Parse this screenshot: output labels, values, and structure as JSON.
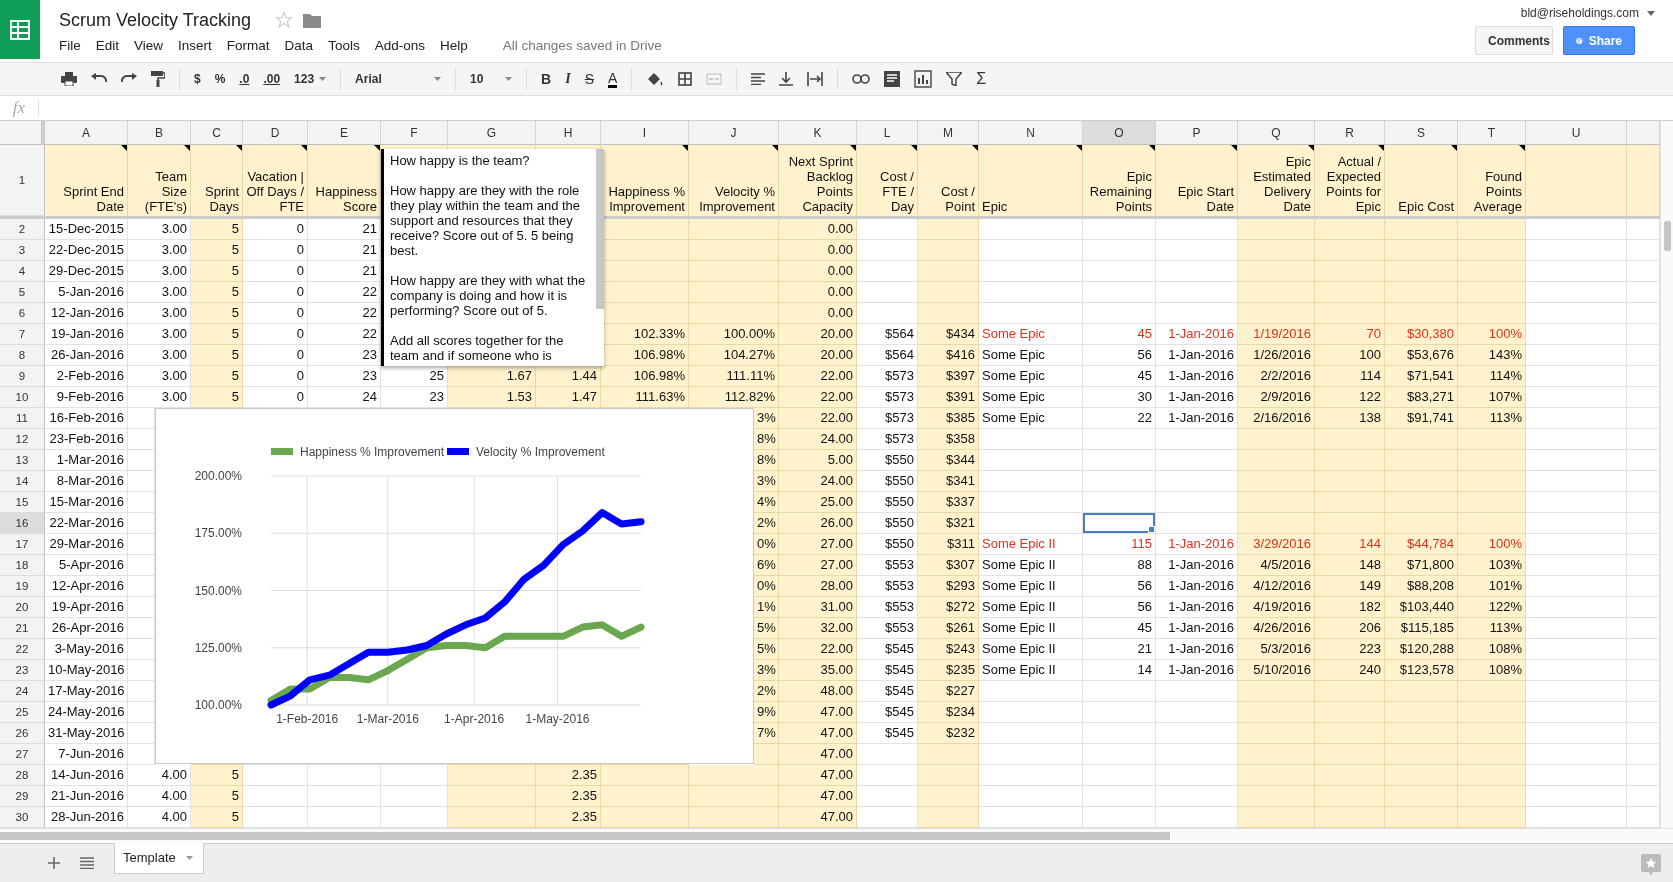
{
  "app": {
    "title": "Scrum Velocity Tracking",
    "starred": false,
    "menu": [
      "File",
      "Edit",
      "View",
      "Insert",
      "Format",
      "Data",
      "Tools",
      "Add-ons",
      "Help"
    ],
    "save_status": "All changes saved in Drive",
    "account": "bld@riseholdings.com",
    "comments_button": "Comments",
    "share_button": "Share"
  },
  "toolbar": {
    "currency": "$",
    "percent": "%",
    "decrease_decimals": ".0",
    "increase_decimals": ".00",
    "more_formats": "123",
    "font": "Arial",
    "font_size": "10",
    "bold": "B",
    "italic": "I",
    "strikethrough": "S",
    "text_color": "A",
    "functions": "Σ"
  },
  "formula_bar": {
    "label": "fx"
  },
  "sheet": {
    "columns": [
      {
        "letter": "A",
        "title": "Sprint End Date",
        "note": true,
        "shaded": false,
        "epic": false,
        "selected": false
      },
      {
        "letter": "B",
        "title": "Team Size (FTE's)",
        "note": true,
        "shaded": false,
        "epic": false,
        "selected": false
      },
      {
        "letter": "C",
        "title": "Sprint Days",
        "note": true,
        "shaded": true,
        "epic": false,
        "selected": false
      },
      {
        "letter": "D",
        "title": "Vacation | Off Days / FTE",
        "note": true,
        "shaded": false,
        "epic": false,
        "selected": false
      },
      {
        "letter": "E",
        "title": "Happiness Score",
        "note": true,
        "shaded": false,
        "epic": false,
        "selected": false
      },
      {
        "letter": "F",
        "shaded": false,
        "epic": false,
        "selected": false
      },
      {
        "letter": "G",
        "shaded": true,
        "epic": false,
        "selected": false
      },
      {
        "letter": "H",
        "shaded": true,
        "epic": false,
        "selected": false
      },
      {
        "letter": "I",
        "title": "Happiness % Improvement",
        "note": true,
        "shaded": true,
        "epic": false,
        "selected": false
      },
      {
        "letter": "J",
        "title": "Velocity % Improvement",
        "note": true,
        "shaded": true,
        "epic": false,
        "selected": false
      },
      {
        "letter": "K",
        "title": "Next Sprint Backlog Points Capacity",
        "note": true,
        "shaded": true,
        "epic": false,
        "selected": false
      },
      {
        "letter": "L",
        "title": "Cost / FTE / Day",
        "note": true,
        "shaded": false,
        "epic": false,
        "selected": false
      },
      {
        "letter": "M",
        "title": "Cost / Point",
        "note": true,
        "shaded": true,
        "epic": false,
        "selected": false
      },
      {
        "letter": "N",
        "title": "Epic",
        "note": true,
        "shaded": false,
        "epic": true,
        "selected": false
      },
      {
        "letter": "O",
        "title": "Epic Remaining Points",
        "note": true,
        "shaded": false,
        "epic": true,
        "selected": true
      },
      {
        "letter": "P",
        "title": "Epic Start Date",
        "note": true,
        "shaded": false,
        "epic": true,
        "selected": false
      },
      {
        "letter": "Q",
        "title": "Epic Estimated Delivery Date",
        "note": true,
        "shaded": true,
        "epic": true,
        "selected": false
      },
      {
        "letter": "R",
        "title": "Actual / Expected Points for Epic",
        "note": true,
        "shaded": true,
        "epic": true,
        "selected": false
      },
      {
        "letter": "S",
        "title": "Epic Cost",
        "note": true,
        "shaded": true,
        "epic": true,
        "selected": false
      },
      {
        "letter": "T",
        "title": "Found Points Average",
        "note": true,
        "shaded": true,
        "epic": true,
        "selected": false
      },
      {
        "letter": "U",
        "note": false,
        "shaded": false,
        "epic": false,
        "selected": false
      }
    ],
    "header_row_number": "1",
    "rows": [
      {
        "number": "2",
        "selected": false,
        "cells": {
          "A": "15-Dec-2015",
          "B": "3.00",
          "C": "5",
          "D": "0",
          "E": "21",
          "K": "0.00"
        }
      },
      {
        "number": "3",
        "selected": false,
        "cells": {
          "A": "22-Dec-2015",
          "B": "3.00",
          "C": "5",
          "D": "0",
          "E": "21",
          "K": "0.00"
        }
      },
      {
        "number": "4",
        "selected": false,
        "cells": {
          "A": "29-Dec-2015",
          "B": "3.00",
          "C": "5",
          "D": "0",
          "E": "21",
          "K": "0.00"
        }
      },
      {
        "number": "5",
        "selected": false,
        "cells": {
          "A": "5-Jan-2016",
          "B": "3.00",
          "C": "5",
          "D": "0",
          "E": "22",
          "K": "0.00"
        }
      },
      {
        "number": "6",
        "selected": false,
        "cells": {
          "A": "12-Jan-2016",
          "B": "3.00",
          "C": "5",
          "D": "0",
          "E": "22",
          "K": "0.00"
        }
      },
      {
        "number": "7",
        "selected": false,
        "highlighted": true,
        "cells": {
          "A": "19-Jan-2016",
          "B": "3.00",
          "C": "5",
          "D": "0",
          "E": "22",
          "I": "102.33%",
          "J": "100.00%",
          "K": "20.00",
          "L": "$564",
          "M": "$434",
          "N": "Some Epic",
          "O": "45",
          "P": "1-Jan-2016",
          "Q": "1/19/2016",
          "R": "70",
          "S": "$30,380",
          "T": "100%"
        }
      },
      {
        "number": "8",
        "selected": false,
        "highlighted": false,
        "cells": {
          "A": "26-Jan-2016",
          "B": "3.00",
          "C": "5",
          "D": "0",
          "E": "23",
          "I": "106.98%",
          "J": "104.27%",
          "K": "20.00",
          "L": "$564",
          "M": "$416",
          "N": "Some Epic",
          "O": "56",
          "P": "1-Jan-2016",
          "Q": "1/26/2016",
          "R": "100",
          "S": "$53,676",
          "T": "143%"
        }
      },
      {
        "number": "9",
        "selected": false,
        "highlighted": false,
        "cells": {
          "A": "2-Feb-2016",
          "B": "3.00",
          "C": "5",
          "D": "0",
          "E": "23",
          "F": "25",
          "G": "1.67",
          "H": "1.44",
          "I": "106.98%",
          "J": "111.11%",
          "K": "22.00",
          "L": "$573",
          "M": "$397",
          "N": "Some Epic",
          "O": "45",
          "P": "1-Jan-2016",
          "Q": "2/2/2016",
          "R": "114",
          "S": "$71,541",
          "T": "114%"
        }
      },
      {
        "number": "10",
        "selected": false,
        "highlighted": false,
        "cells": {
          "A": "9-Feb-2016",
          "B": "3.00",
          "C": "5",
          "D": "0",
          "E": "24",
          "F": "23",
          "G": "1.53",
          "H": "1.47",
          "I": "111.63%",
          "J": "112.82%",
          "K": "22.00",
          "L": "$573",
          "M": "$391",
          "N": "Some Epic",
          "O": "30",
          "P": "1-Jan-2016",
          "Q": "2/9/2016",
          "R": "122",
          "S": "$83,271",
          "T": "107%"
        }
      },
      {
        "number": "11",
        "selected": false,
        "highlighted": false,
        "cells": {
          "A": "16-Feb-2016",
          "J": "3%",
          "K": "22.00",
          "L": "$573",
          "M": "$385",
          "N": "Some Epic",
          "O": "22",
          "P": "1-Jan-2016",
          "Q": "2/16/2016",
          "R": "138",
          "S": "$91,741",
          "T": "113%"
        }
      },
      {
        "number": "12",
        "selected": false,
        "cells": {
          "A": "23-Feb-2016",
          "J": "8%",
          "K": "24.00",
          "L": "$573",
          "M": "$358"
        }
      },
      {
        "number": "13",
        "selected": false,
        "cells": {
          "A": "1-Mar-2016",
          "J": "8%",
          "K": "5.00",
          "L": "$550",
          "M": "$344"
        }
      },
      {
        "number": "14",
        "selected": false,
        "cells": {
          "A": "8-Mar-2016",
          "J": "3%",
          "K": "24.00",
          "L": "$550",
          "M": "$341"
        }
      },
      {
        "number": "15",
        "selected": false,
        "cells": {
          "A": "15-Mar-2016",
          "J": "4%",
          "K": "25.00",
          "L": "$550",
          "M": "$337"
        }
      },
      {
        "number": "16",
        "selected": true,
        "cells": {
          "A": "22-Mar-2016",
          "J": "2%",
          "K": "26.00",
          "L": "$550",
          "M": "$321"
        }
      },
      {
        "number": "17",
        "selected": false,
        "highlighted": true,
        "cells": {
          "A": "29-Mar-2016",
          "J": "0%",
          "K": "27.00",
          "L": "$550",
          "M": "$311",
          "N": "Some Epic II",
          "O": "115",
          "P": "1-Jan-2016",
          "Q": "3/29/2016",
          "R": "144",
          "S": "$44,784",
          "T": "100%"
        }
      },
      {
        "number": "18",
        "selected": false,
        "highlighted": false,
        "cells": {
          "A": "5-Apr-2016",
          "J": "6%",
          "K": "27.00",
          "L": "$553",
          "M": "$307",
          "N": "Some Epic II",
          "O": "88",
          "P": "1-Jan-2016",
          "Q": "4/5/2016",
          "R": "148",
          "S": "$71,800",
          "T": "103%"
        }
      },
      {
        "number": "19",
        "selected": false,
        "highlighted": false,
        "cells": {
          "A": "12-Apr-2016",
          "J": "0%",
          "K": "28.00",
          "L": "$553",
          "M": "$293",
          "N": "Some Epic II",
          "O": "56",
          "P": "1-Jan-2016",
          "Q": "4/12/2016",
          "R": "149",
          "S": "$88,208",
          "T": "101%"
        }
      },
      {
        "number": "20",
        "selected": false,
        "highlighted": false,
        "cells": {
          "A": "19-Apr-2016",
          "J": "1%",
          "K": "31.00",
          "L": "$553",
          "M": "$272",
          "N": "Some Epic II",
          "O": "56",
          "P": "1-Jan-2016",
          "Q": "4/19/2016",
          "R": "182",
          "S": "$103,440",
          "T": "122%"
        }
      },
      {
        "number": "21",
        "selected": false,
        "highlighted": false,
        "cells": {
          "A": "26-Apr-2016",
          "J": "5%",
          "K": "32.00",
          "L": "$553",
          "M": "$261",
          "N": "Some Epic II",
          "O": "45",
          "P": "1-Jan-2016",
          "Q": "4/26/2016",
          "R": "206",
          "S": "$115,185",
          "T": "113%"
        }
      },
      {
        "number": "22",
        "selected": false,
        "highlighted": false,
        "cells": {
          "A": "3-May-2016",
          "J": "5%",
          "K": "22.00",
          "L": "$545",
          "M": "$243",
          "N": "Some Epic II",
          "O": "21",
          "P": "1-Jan-2016",
          "Q": "5/3/2016",
          "R": "223",
          "S": "$120,288",
          "T": "108%"
        }
      },
      {
        "number": "23",
        "selected": false,
        "highlighted": false,
        "cells": {
          "A": "10-May-2016",
          "J": "3%",
          "K": "35.00",
          "L": "$545",
          "M": "$235",
          "N": "Some Epic II",
          "O": "14",
          "P": "1-Jan-2016",
          "Q": "5/10/2016",
          "R": "240",
          "S": "$123,578",
          "T": "108%"
        }
      },
      {
        "number": "24",
        "selected": false,
        "cells": {
          "A": "17-May-2016",
          "J": "2%",
          "K": "48.00",
          "L": "$545",
          "M": "$227"
        }
      },
      {
        "number": "25",
        "selected": false,
        "cells": {
          "A": "24-May-2016",
          "J": "9%",
          "K": "47.00",
          "L": "$545",
          "M": "$234"
        }
      },
      {
        "number": "26",
        "selected": false,
        "cells": {
          "A": "31-May-2016",
          "J": "7%",
          "K": "47.00",
          "L": "$545",
          "M": "$232"
        }
      },
      {
        "number": "27",
        "selected": false,
        "cells": {
          "A": "7-Jun-2016",
          "K": "47.00"
        }
      },
      {
        "number": "28",
        "selected": false,
        "cells": {
          "A": "14-Jun-2016",
          "B": "4.00",
          "C": "5",
          "H": "2.35",
          "K": "47.00"
        }
      },
      {
        "number": "29",
        "selected": false,
        "cells": {
          "A": "21-Jun-2016",
          "B": "4.00",
          "C": "5",
          "H": "2.35",
          "K": "47.00"
        }
      },
      {
        "number": "30",
        "selected": false,
        "cells": {
          "A": "28-Jun-2016",
          "B": "4.00",
          "C": "5",
          "H": "2.35",
          "K": "47.00"
        }
      }
    ]
  },
  "note_popup": {
    "paragraphs": [
      "How happy is the team?",
      "How happy are they with the role they play within the team and the support and resources that they receive? Score out of 5. 5 being best.",
      "How happy are they with what the company is doing and how it is performing? Score out of 5.",
      "Add all scores together for the team and if someone who is"
    ]
  },
  "chart": {
    "chart_data": {
      "type": "line",
      "x": [
        "2016-01-19",
        "2016-01-26",
        "2016-02-02",
        "2016-02-09",
        "2016-02-16",
        "2016-02-23",
        "2016-03-01",
        "2016-03-08",
        "2016-03-15",
        "2016-03-22",
        "2016-03-29",
        "2016-04-05",
        "2016-04-12",
        "2016-04-19",
        "2016-04-26",
        "2016-05-03",
        "2016-05-10",
        "2016-05-17",
        "2016-05-24",
        "2016-05-31"
      ],
      "series": [
        {
          "name": "Happiness % Improvement",
          "color": "#6aa84f",
          "values": [
            102,
            107,
            107,
            112,
            112,
            111,
            115,
            120,
            125,
            126,
            126,
            125,
            130,
            130,
            130,
            130,
            134,
            135,
            130,
            134
          ]
        },
        {
          "name": "Velocity % Improvement",
          "color": "#0000ff",
          "values": [
            100,
            104,
            111,
            113,
            118,
            123,
            123,
            124,
            126,
            131,
            135,
            138,
            145,
            155,
            161,
            170,
            176,
            184,
            179,
            180
          ]
        }
      ],
      "ylim": [
        100,
        200
      ],
      "yticks": [
        {
          "value": 100,
          "label": "100.00%"
        },
        {
          "value": 125,
          "label": "125.00%"
        },
        {
          "value": 150,
          "label": "150.00%"
        },
        {
          "value": 175,
          "label": "175.00%"
        },
        {
          "value": 200,
          "label": "200.00%"
        }
      ],
      "xticks": [
        {
          "value": "2016-02-01",
          "label": "1-Feb-2016"
        },
        {
          "value": "2016-03-01",
          "label": "1-Mar-2016"
        },
        {
          "value": "2016-04-01",
          "label": "1-Apr-2016"
        },
        {
          "value": "2016-05-01",
          "label": "1-May-2016"
        }
      ],
      "grid": true,
      "xlim": [
        "2016-01-19",
        "2016-05-31"
      ],
      "legend": "top"
    }
  },
  "sheet_tabs": [
    {
      "label": "Template",
      "selected": true
    }
  ]
}
